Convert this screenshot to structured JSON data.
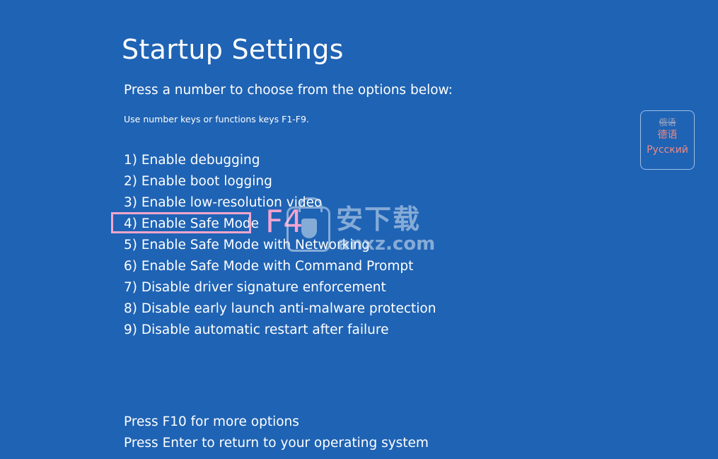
{
  "screen": {
    "title": "Startup Settings",
    "subtitle": "Press a number to choose from the options below:",
    "hint": "Use number keys or functions keys F1-F9."
  },
  "options": [
    {
      "label": "1) Enable debugging"
    },
    {
      "label": "2) Enable boot logging"
    },
    {
      "label": "3) Enable low-resolution video"
    },
    {
      "label": "4) Enable Safe Mode"
    },
    {
      "label": "5) Enable Safe Mode with Networking"
    },
    {
      "label": "6) Enable Safe Mode with Command Prompt"
    },
    {
      "label": "7) Disable driver signature enforcement"
    },
    {
      "label": "8) Disable early launch anti-malware protection"
    },
    {
      "label": "9) Disable automatic restart after failure"
    }
  ],
  "annotation": {
    "key": "F4",
    "highlighted_option": "4) Enable Safe Mode",
    "highlight_color": "#f2a6cd"
  },
  "watermark": {
    "text_cn": "安下载",
    "domain": "anxz.com"
  },
  "language_panel": {
    "line1": "俄语",
    "line2": "德语",
    "line3": "Русский"
  },
  "footer": {
    "more_options": "Press F10 for more options",
    "return": "Press Enter to return to your operating system"
  },
  "colors": {
    "background": "#1f63b4",
    "text": "#ffffff",
    "language_text": "#f08a84"
  }
}
